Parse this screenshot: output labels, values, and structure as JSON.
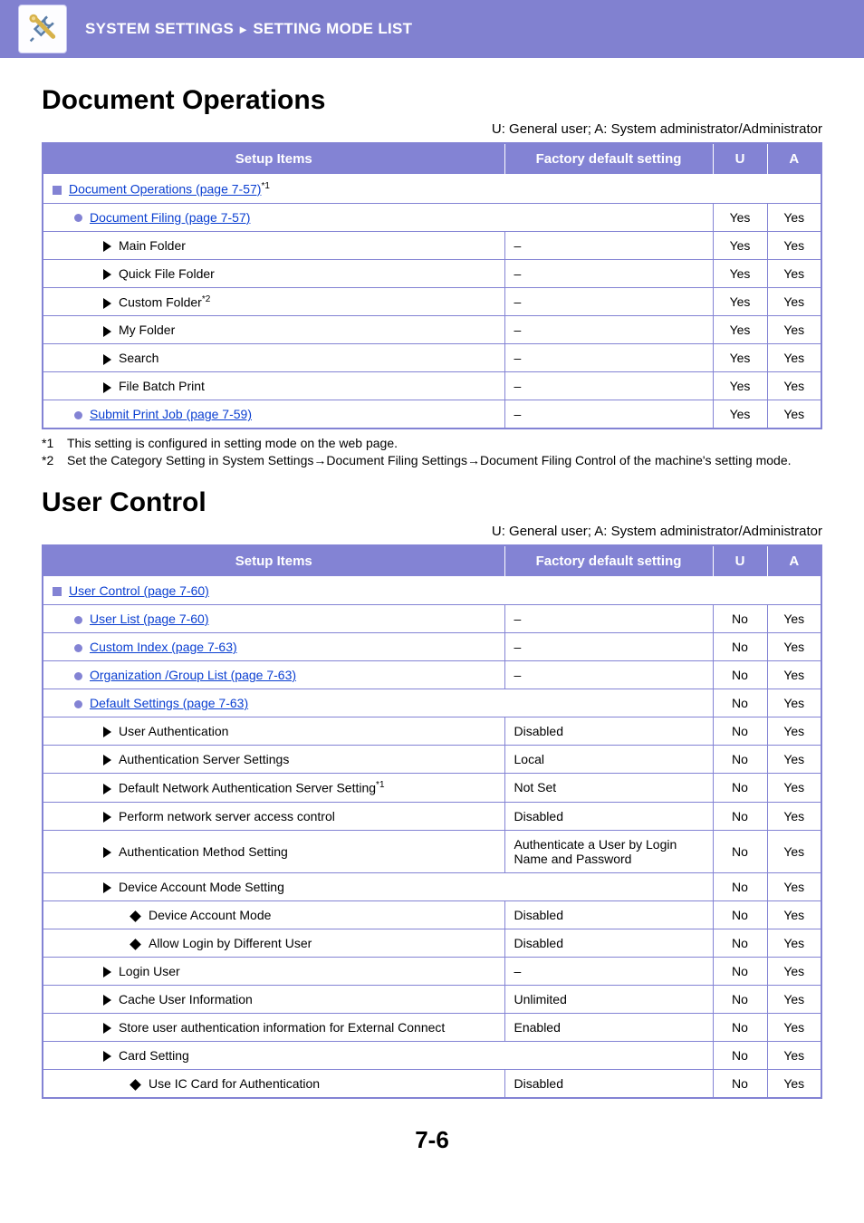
{
  "header": {
    "breadcrumb_left": "SYSTEM SETTINGS",
    "breadcrumb_right": "SETTING MODE LIST"
  },
  "legend": "U: General user; A: System administrator/Administrator",
  "columns": {
    "setup_items": "Setup Items",
    "factory_default": "Factory default setting",
    "u": "U",
    "a": "A"
  },
  "sections": [
    {
      "title": "Document Operations",
      "footnotes": [
        {
          "label": "*1",
          "text": "This setting is configured in setting mode on the web page."
        },
        {
          "label": "*2",
          "text": "Set the Category Setting in System Settings→Document Filing Settings→Document Filing Control of the machine's setting mode."
        }
      ],
      "rows": [
        {
          "indent": 0,
          "bullet": "sq",
          "link": true,
          "label": "Document Operations (page 7-57)",
          "sup": "*1",
          "fd": null,
          "u": null,
          "a": null,
          "span": true
        },
        {
          "indent": 1,
          "bullet": "circ",
          "link": true,
          "label": "Document Filing (page 7-57)",
          "fd": null,
          "u": "Yes",
          "a": "Yes",
          "spanfd": true
        },
        {
          "indent": 2,
          "bullet": "tri",
          "link": false,
          "label": "Main Folder",
          "fd": "–",
          "u": "Yes",
          "a": "Yes"
        },
        {
          "indent": 2,
          "bullet": "tri",
          "link": false,
          "label": "Quick File Folder",
          "fd": "–",
          "u": "Yes",
          "a": "Yes"
        },
        {
          "indent": 2,
          "bullet": "tri",
          "link": false,
          "label": "Custom Folder",
          "sup": "*2",
          "fd": "–",
          "u": "Yes",
          "a": "Yes"
        },
        {
          "indent": 2,
          "bullet": "tri",
          "link": false,
          "label": "My Folder",
          "fd": "–",
          "u": "Yes",
          "a": "Yes"
        },
        {
          "indent": 2,
          "bullet": "tri",
          "link": false,
          "label": "Search",
          "fd": "–",
          "u": "Yes",
          "a": "Yes"
        },
        {
          "indent": 2,
          "bullet": "tri",
          "link": false,
          "label": "File Batch Print",
          "fd": "–",
          "u": "Yes",
          "a": "Yes"
        },
        {
          "indent": 1,
          "bullet": "circ",
          "link": true,
          "label": "Submit Print Job (page 7-59)",
          "fd": "–",
          "u": "Yes",
          "a": "Yes"
        }
      ]
    },
    {
      "title": "User Control",
      "footnotes": [],
      "rows": [
        {
          "indent": 0,
          "bullet": "sq",
          "link": true,
          "label": "User Control (page 7-60)",
          "fd": null,
          "u": null,
          "a": null,
          "span": true
        },
        {
          "indent": 1,
          "bullet": "circ",
          "link": true,
          "label": "User List (page 7-60)",
          "fd": "–",
          "u": "No",
          "a": "Yes"
        },
        {
          "indent": 1,
          "bullet": "circ",
          "link": true,
          "label": "Custom Index (page 7-63)",
          "fd": "–",
          "u": "No",
          "a": "Yes"
        },
        {
          "indent": 1,
          "bullet": "circ",
          "link": true,
          "label": "Organization /Group List (page 7-63)",
          "fd": "–",
          "u": "No",
          "a": "Yes"
        },
        {
          "indent": 1,
          "bullet": "circ",
          "link": true,
          "label": "Default Settings (page 7-63)",
          "fd": null,
          "u": "No",
          "a": "Yes",
          "spanfd": true
        },
        {
          "indent": 2,
          "bullet": "tri",
          "link": false,
          "label": "User Authentication",
          "fd": "Disabled",
          "u": "No",
          "a": "Yes"
        },
        {
          "indent": 2,
          "bullet": "tri",
          "link": false,
          "label": "Authentication Server Settings",
          "fd": "Local",
          "u": "No",
          "a": "Yes"
        },
        {
          "indent": 2,
          "bullet": "tri",
          "link": false,
          "label": "Default Network Authentication Server Setting",
          "sup": "*1",
          "fd": "Not Set",
          "u": "No",
          "a": "Yes"
        },
        {
          "indent": 2,
          "bullet": "tri",
          "link": false,
          "label": "Perform network server access control",
          "fd": "Disabled",
          "u": "No",
          "a": "Yes"
        },
        {
          "indent": 2,
          "bullet": "tri",
          "link": false,
          "label": "Authentication Method Setting",
          "fd": "Authenticate a User by Login Name and Password",
          "u": "No",
          "a": "Yes"
        },
        {
          "indent": 2,
          "bullet": "tri",
          "link": false,
          "label": "Device Account Mode Setting",
          "fd": null,
          "u": "No",
          "a": "Yes",
          "spanfd": true
        },
        {
          "indent": 3,
          "bullet": "diam",
          "link": false,
          "label": "Device Account Mode",
          "fd": "Disabled",
          "u": "No",
          "a": "Yes"
        },
        {
          "indent": 3,
          "bullet": "diam",
          "link": false,
          "label": "Allow Login by Different User",
          "fd": "Disabled",
          "u": "No",
          "a": "Yes"
        },
        {
          "indent": 2,
          "bullet": "tri",
          "link": false,
          "label": "Login User",
          "fd": "–",
          "u": "No",
          "a": "Yes"
        },
        {
          "indent": 2,
          "bullet": "tri",
          "link": false,
          "label": "Cache User Information",
          "fd": "Unlimited",
          "u": "No",
          "a": "Yes"
        },
        {
          "indent": 2,
          "bullet": "tri",
          "link": false,
          "label": "Store user authentication information for External Connect",
          "fd": "Enabled",
          "u": "No",
          "a": "Yes"
        },
        {
          "indent": 2,
          "bullet": "tri",
          "link": false,
          "label": "Card Setting",
          "fd": null,
          "u": "No",
          "a": "Yes",
          "spanfd": true
        },
        {
          "indent": 3,
          "bullet": "diam",
          "link": false,
          "label": "Use IC Card for Authentication",
          "fd": "Disabled",
          "u": "No",
          "a": "Yes"
        }
      ]
    }
  ],
  "page_number": "7-6"
}
